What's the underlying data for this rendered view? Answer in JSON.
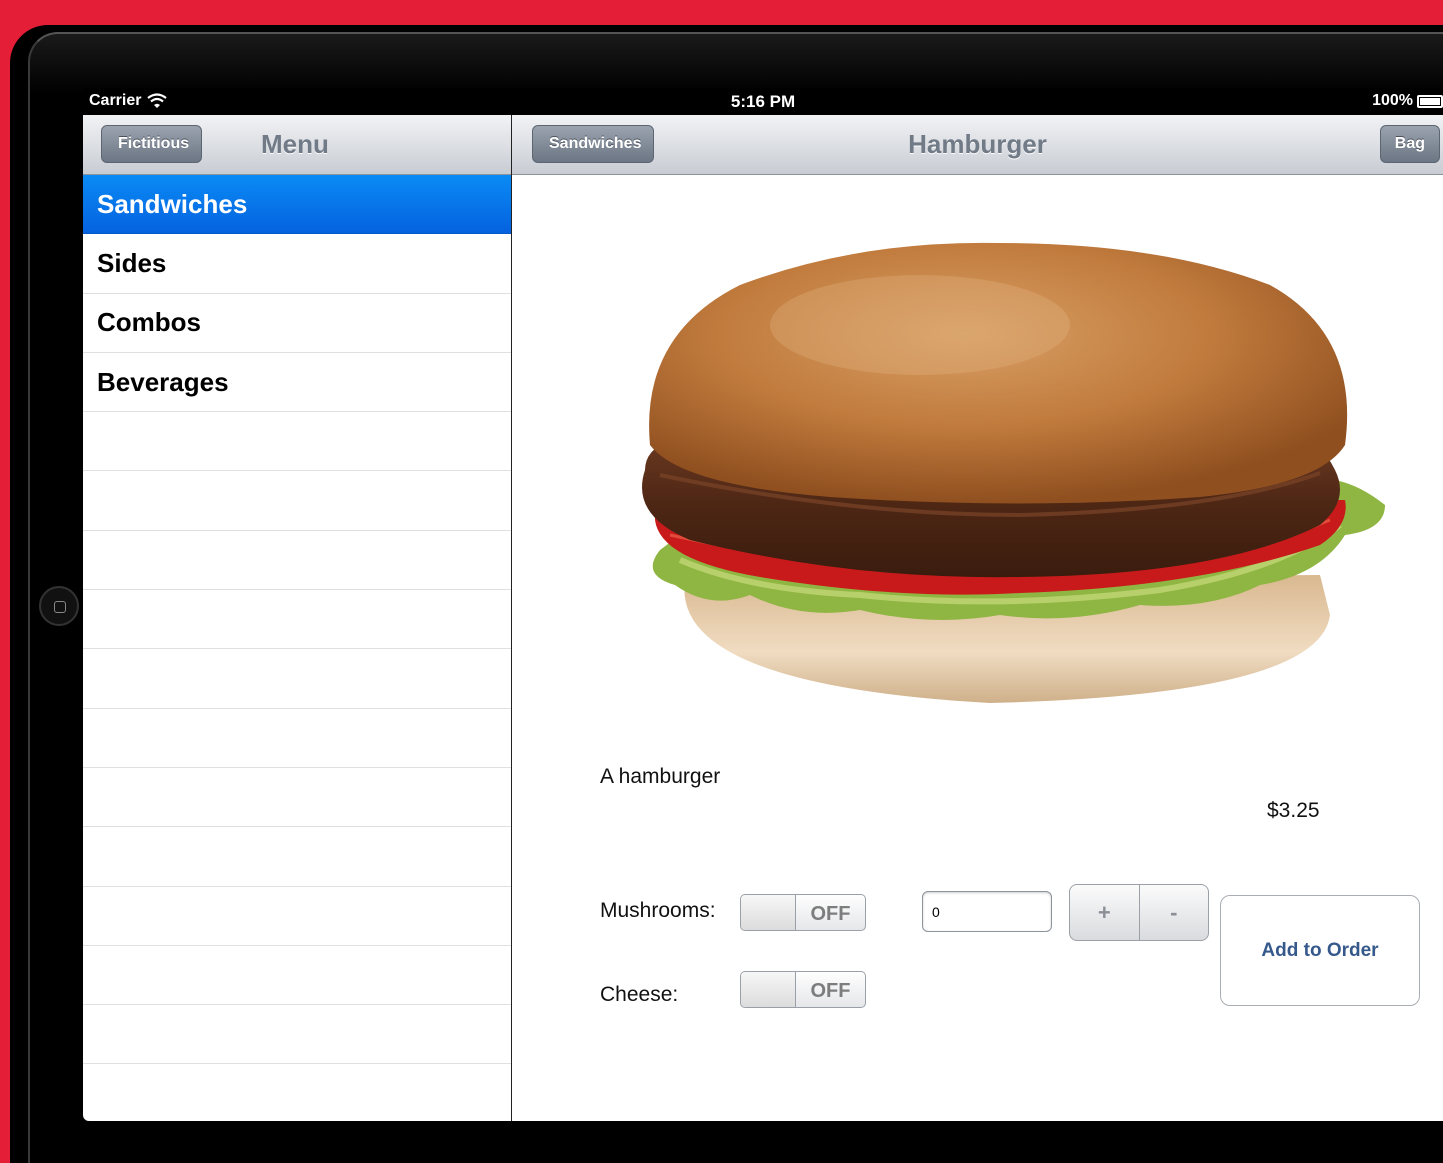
{
  "status_bar": {
    "carrier": "Carrier",
    "time": "5:16 PM",
    "battery": "100%",
    "battery_level": 1.0
  },
  "master": {
    "back_label": "Fictitious",
    "title": "Menu",
    "items": [
      {
        "label": "Sandwiches",
        "selected": true
      },
      {
        "label": "Sides",
        "selected": false
      },
      {
        "label": "Combos",
        "selected": false
      },
      {
        "label": "Beverages",
        "selected": false
      }
    ]
  },
  "detail": {
    "back_label": "Sandwiches",
    "title": "Hamburger",
    "bag_label": "Bag",
    "description": "A hamburger",
    "price": "$3.25",
    "options": {
      "mushrooms_label": "Mushrooms:",
      "mushrooms_state": "OFF",
      "cheese_label": "Cheese:",
      "cheese_state": "OFF"
    },
    "quantity_value": "0",
    "stepper": {
      "plus": "+",
      "minus": "-"
    },
    "add_to_order_label": "Add to Order"
  },
  "colors": {
    "background": "#e31e36",
    "selected_row": "#0a6ff0",
    "add_button_text": "#36598c"
  },
  "icons": [
    "wifi-icon",
    "battery-icon",
    "home-button",
    "burger-image"
  ]
}
